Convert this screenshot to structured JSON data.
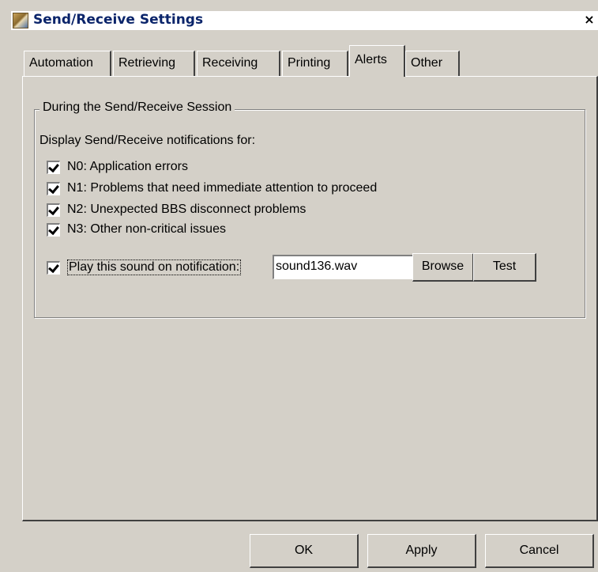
{
  "window": {
    "title": "Send/Receive Settings",
    "close_glyph": "×",
    "icon": "app-icon"
  },
  "tabs": [
    {
      "label": "Automation",
      "active": false
    },
    {
      "label": "Retrieving",
      "active": false
    },
    {
      "label": "Receiving",
      "active": false
    },
    {
      "label": "Printing",
      "active": false
    },
    {
      "label": "Alerts",
      "active": true
    },
    {
      "label": "Other",
      "active": false
    }
  ],
  "group": {
    "title": "During the Send/Receive Session",
    "notifications_label": "Display Send/Receive notifications for:",
    "items": [
      {
        "label": "N0: Application errors",
        "checked": true
      },
      {
        "label": "N1: Problems that need immediate attention to proceed",
        "checked": true
      },
      {
        "label": "N2: Unexpected BBS disconnect problems",
        "checked": true
      },
      {
        "label": "N3: Other non-critical issues",
        "checked": true
      }
    ],
    "sound": {
      "label": "Play this sound on notification:",
      "checked": true,
      "file": "sound136.wav",
      "browse_label": "Browse",
      "test_label": "Test"
    }
  },
  "footer": {
    "ok_label": "OK",
    "apply_label": "Apply",
    "cancel_label": "Cancel"
  }
}
